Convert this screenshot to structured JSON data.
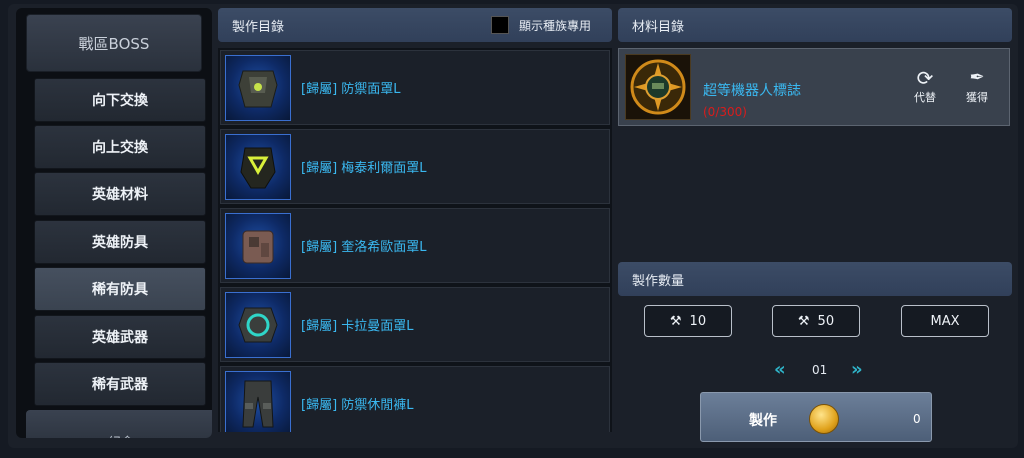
{
  "menu": {
    "header": "戰區BOSS",
    "items": [
      {
        "label": "向下交換",
        "active": false
      },
      {
        "label": "向上交換",
        "active": false
      },
      {
        "label": "英雄材料",
        "active": false
      },
      {
        "label": "英雄防具",
        "active": false
      },
      {
        "label": "稀有防具",
        "active": true
      },
      {
        "label": "英雄武器",
        "active": false
      },
      {
        "label": "稀有武器",
        "active": false
      }
    ],
    "partial_item": "紀念"
  },
  "craft_list": {
    "title": "製作目錄",
    "toggle_label": "顯示種族專用",
    "items": [
      {
        "name": "[歸屬] 防禦面罩L"
      },
      {
        "name": "[歸屬] 梅泰利爾面罩L"
      },
      {
        "name": "[歸屬] 奎洛希歐面罩L"
      },
      {
        "name": "[歸屬] 卡拉曼面罩L"
      },
      {
        "name": "[歸屬] 防禦休閒褲L"
      }
    ]
  },
  "materials": {
    "title": "材料目錄",
    "item": {
      "name": "超等機器人標誌",
      "count": "(0/300)"
    },
    "replace_label": "代替",
    "obtain_label": "獲得"
  },
  "quantity": {
    "title": "製作數量",
    "btn_10": "10",
    "btn_50": "50",
    "btn_max": "MAX",
    "page": "01"
  },
  "craft_button": {
    "label": "製作",
    "cost": "0"
  },
  "colors": {
    "item_name": "#3ab8f0",
    "count_red": "#d81c1c",
    "header_blue": "#3c4c66"
  }
}
